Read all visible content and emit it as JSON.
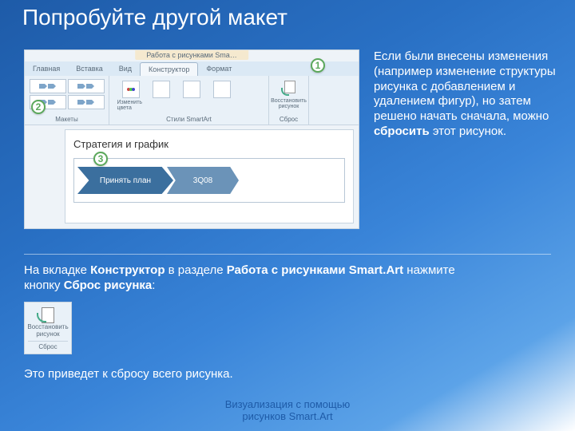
{
  "title": "Попробуйте другой макет",
  "screenshot": {
    "tooltab_title": "Работа с рисунками Sma…",
    "tabs": {
      "home": "Главная",
      "insert": "Вставка",
      "view": "Вид",
      "design": "Конструктор",
      "format": "Формат"
    },
    "groups": {
      "layouts_label": "Макеты",
      "styles_label": "Стили SmartArt",
      "change_colors": "Изменить цвета",
      "reset_label": "Восстановить рисунок",
      "reset_group": "Сброс"
    },
    "doc_title": "Стратегия и график",
    "chevrons": {
      "c1": "Принять план",
      "c2": "3Q08"
    },
    "callouts": {
      "c1": "1",
      "c2": "2",
      "c3": "3"
    }
  },
  "side_paragraph": {
    "t1": "Если были внесены изменения (например изменение структуры рисунка с добавлением и удалением фигур), но затем решено начать сначала, можно ",
    "t2": "сбросить",
    "t3": " этот рисунок."
  },
  "instruction": {
    "t1": "На вкладке ",
    "t2": "Конструктор",
    "t3": " в разделе ",
    "t4": "Работа с рисунками Smart.Art",
    "t5": " нажмите кнопку ",
    "t6": "Сброс рисунка",
    "t7": ":"
  },
  "reset_widget": {
    "label": "Восстановить рисунок",
    "group": "Сброс"
  },
  "instruction2": "Это приведет к сбросу всего рисунка.",
  "footer": {
    "l1": "Визуализация с помощью",
    "l2": "рисунков Smart.Art"
  }
}
